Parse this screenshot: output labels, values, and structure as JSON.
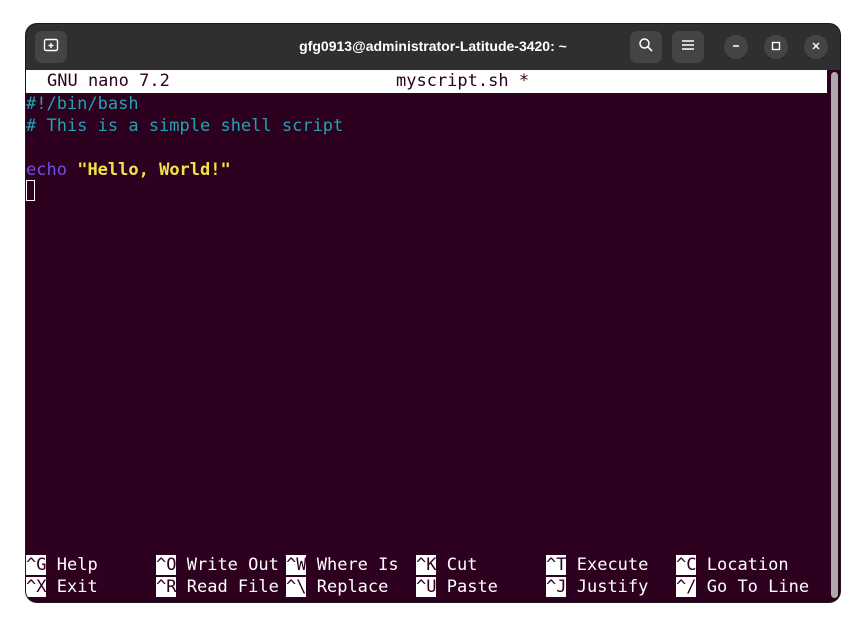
{
  "window": {
    "title": "gfg0913@administrator-Latitude-3420: ~"
  },
  "icons": {
    "new_tab": "new-tab-icon",
    "search": "search-icon",
    "menu": "hamburger-menu-icon",
    "minimize": "minimize-icon",
    "maximize": "maximize-icon",
    "close": "close-icon"
  },
  "nano": {
    "version": "GNU nano 7.2",
    "filename": "myscript.sh *"
  },
  "code": {
    "line1": "#!/bin/bash",
    "line2": "# This is a simple shell script",
    "line3": "",
    "line4_keyword": "echo",
    "line4_string": "\"Hello, World!\""
  },
  "shortcuts": {
    "row1": [
      {
        "key": "^G",
        "label": "Help"
      },
      {
        "key": "^O",
        "label": "Write Out"
      },
      {
        "key": "^W",
        "label": "Where Is"
      },
      {
        "key": "^K",
        "label": "Cut"
      },
      {
        "key": "^T",
        "label": "Execute"
      },
      {
        "key": "^C",
        "label": "Location"
      }
    ],
    "row2": [
      {
        "key": "^X",
        "label": "Exit"
      },
      {
        "key": "^R",
        "label": "Read File"
      },
      {
        "key": "^\\",
        "label": "Replace"
      },
      {
        "key": "^U",
        "label": "Paste"
      },
      {
        "key": "^J",
        "label": "Justify"
      },
      {
        "key": "^/",
        "label": "Go To Line"
      }
    ]
  },
  "colors": {
    "terminal_bg": "#2c001e",
    "comment": "#21a3b1",
    "keyword": "#6a52e8",
    "string": "#f0e34a",
    "titlebar_bg": "#2f2f2f"
  }
}
